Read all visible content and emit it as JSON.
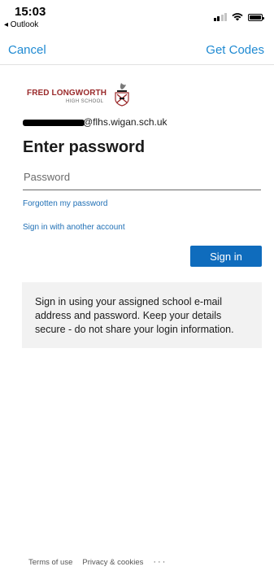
{
  "status_bar": {
    "time": "15:03",
    "back_app": "◂ Outlook"
  },
  "nav": {
    "cancel": "Cancel",
    "get_codes": "Get Codes"
  },
  "logo": {
    "school_name": "FRED LONGWORTH",
    "school_sub": "HIGH SCHOOL"
  },
  "account": {
    "email_domain": "@flhs.wigan.sch.uk"
  },
  "title": "Enter password",
  "password": {
    "placeholder": "Password",
    "value": ""
  },
  "links": {
    "forgot": "Forgotten my password",
    "other_account": "Sign in with another account"
  },
  "sign_in_button": "Sign in",
  "info_text": "Sign in using your assigned school e-mail address and password. Keep your details secure - do not share your login information.",
  "footer": {
    "terms": "Terms of use",
    "privacy": "Privacy & cookies",
    "more": "···"
  },
  "colors": {
    "accent": "#1f8ad2",
    "button": "#0f6cbd",
    "brand": "#9a2a2b",
    "info_bg": "#f2f2f2"
  }
}
